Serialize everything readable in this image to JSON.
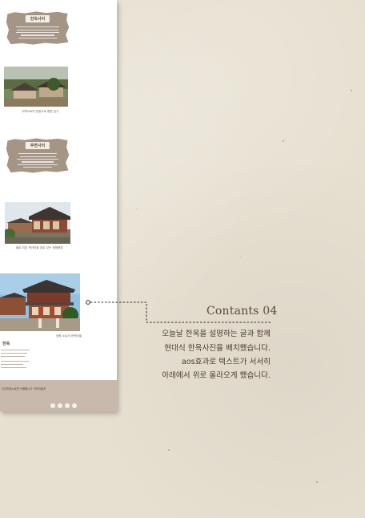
{
  "mockup": {
    "card1_title": "한옥사이",
    "card2_title": "주변사이",
    "photo1_caption": "고택으로의 운동으로 향한 입구",
    "photo2_caption": "돌로 지은 백산마을 집로 닫는 정원풍경",
    "photo3_caption": "정원 소유의 한옥마을",
    "section_label": "한옥",
    "footer_text": "디자인예시로만 사용합니다    이미지출처"
  },
  "annotation": {
    "title": "Contants 04",
    "lines": [
      "오늘날 한옥을 설명하는 글과 함께",
      "현대식 한옥사진을 배치했습니다.",
      "aos효과로 텍스트가 서서히",
      "아래에서 위로 올라오게 했습니다."
    ]
  },
  "colors": {
    "background": "#e7e0d1",
    "torn_paper": "#a49585",
    "footer": "#c9b9ac",
    "text": "#4a3c2e",
    "connector": "#2e2a26"
  },
  "icons": [
    "circle-icon",
    "instagram-icon",
    "twitter-icon",
    "facebook-icon"
  ]
}
